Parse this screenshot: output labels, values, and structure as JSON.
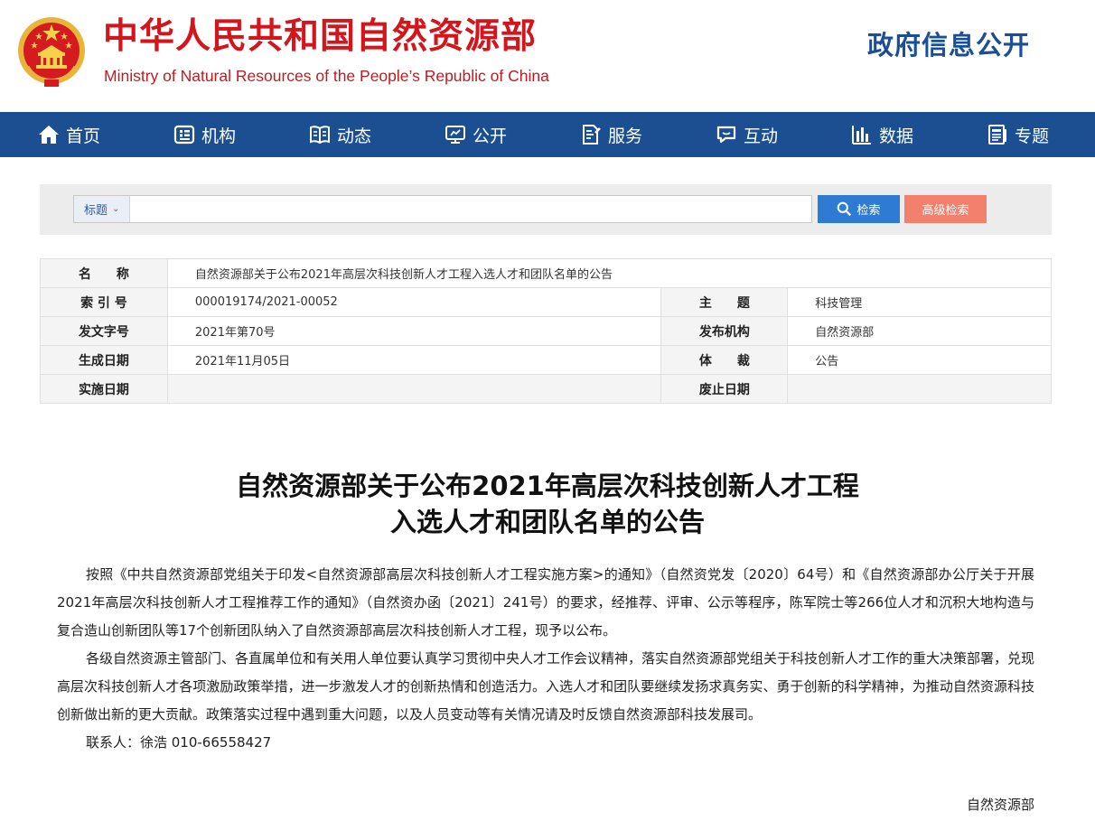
{
  "header": {
    "title": "中华人民共和国自然资源部",
    "subtitle": "Ministry of Natural Resources of the People’s Republic of China",
    "gov_open": "政府信息公开",
    "emblem_icon": "national-emblem-icon"
  },
  "nav": {
    "items": [
      {
        "label": "首页",
        "icon": "home-icon"
      },
      {
        "label": "机构",
        "icon": "organization-icon"
      },
      {
        "label": "动态",
        "icon": "news-book-icon"
      },
      {
        "label": "公开",
        "icon": "monitor-icon"
      },
      {
        "label": "服务",
        "icon": "document-edit-icon"
      },
      {
        "label": "互动",
        "icon": "chat-bubble-icon"
      },
      {
        "label": "数据",
        "icon": "bar-chart-icon"
      },
      {
        "label": "专题",
        "icon": "topic-icon"
      }
    ]
  },
  "search": {
    "field_select": "标题",
    "query": "",
    "search_label": "检索",
    "advanced_label": "高级检索"
  },
  "info": {
    "name_label": "名　　称",
    "name_value": "自然资源部关于公布2021年高层次科技创新人才工程入选人才和团队名单的公告",
    "index_label": "索 引 号",
    "index_value": "000019174/2021-00052",
    "topic_label": "主　　题",
    "topic_value": "科技管理",
    "doc_no_label": "发文字号",
    "doc_no_value": "2021年第70号",
    "publisher_label": "发布机构",
    "publisher_value": "自然资源部",
    "created_label": "生成日期",
    "created_value": "2021年11月05日",
    "genre_label": "体　　裁",
    "genre_value": "公告",
    "effective_label": "实施日期",
    "effective_value": "",
    "repeal_label": "废止日期",
    "repeal_value": ""
  },
  "article": {
    "title_line1": "自然资源部关于公布2021年高层次科技创新人才工程",
    "title_line2": "入选人才和团队名单的公告",
    "paragraph1": "按照《中共自然资源部党组关于印发<自然资源部高层次科技创新人才工程实施方案>的通知》（自然资党发〔2020〕64号）和《自然资源部办公厅关于开展2021年高层次科技创新人才工程推荐工作的通知》（自然资办函〔2021〕241号）的要求，经推荐、评审、公示等程序，陈军院士等266位人才和沉积大地构造与复合造山创新团队等17个创新团队纳入了自然资源部高层次科技创新人才工程，现予以公布。",
    "paragraph2": "各级自然资源主管部门、各直属单位和有关用人单位要认真学习贯彻中央人才工作会议精神，落实自然资源部党组关于科技创新人才工作的重大决策部署，兑现高层次科技创新人才各项激励政策举措，进一步激发人才的创新热情和创造活力。入选人才和团队要继续发扬求真务实、勇于创新的科学精神，为推动自然资源科技创新做出新的更大贡献。政策落实过程中遇到重大问题，以及人员变动等有关情况请及时反馈自然资源部科技发展司。",
    "contact": "联系人：徐浩 010-66558427",
    "signature": "自然资源部"
  },
  "colors": {
    "brand_red": "#d4151b",
    "nav_blue": "#1b4f92",
    "search_blue": "#2e7bd4",
    "advanced_orange": "#f3806c"
  }
}
